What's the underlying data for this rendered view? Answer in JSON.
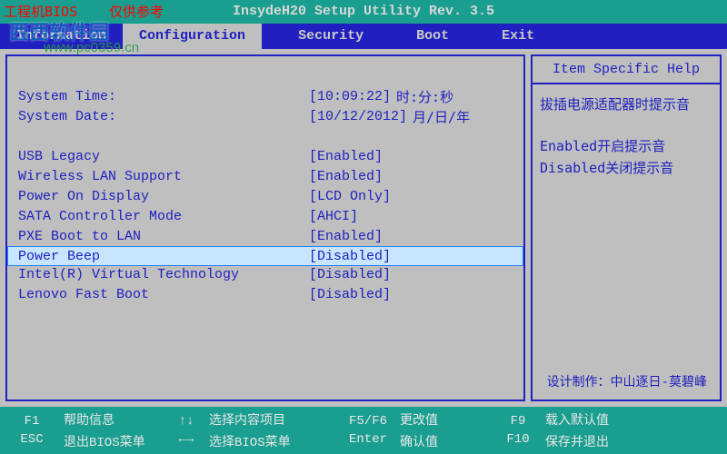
{
  "watermark": {
    "bios": "工程机BIOS",
    "ref": "仅供参考",
    "site": "西西软件园",
    "url": "www.pc0359.cn"
  },
  "header": {
    "title": "InsydeH20 Setup Utility Rev. 3.5"
  },
  "tabs": [
    "Information",
    "Configuration",
    "Security",
    "Boot",
    "Exit"
  ],
  "active_tab": "Configuration",
  "fields": {
    "time_label": "System Time:",
    "time_val": "[10:09:22]",
    "time_note": "时:分:秒",
    "date_label": "System Date:",
    "date_val": "[10/12/2012]",
    "date_note": "月/日/年",
    "usb_label": "USB Legacy",
    "usb_val": "[Enabled]",
    "wlan_label": "Wireless LAN Support",
    "wlan_val": "[Enabled]",
    "pod_label": "Power On Display",
    "pod_val": "[LCD Only]",
    "sata_label": "SATA Controller Mode",
    "sata_val": "[AHCI]",
    "pxe_label": "PXE Boot to LAN",
    "pxe_val": "[Enabled]",
    "beep_label": "Power Beep",
    "beep_val": "[Disabled]",
    "vt_label": "Intel(R) Virtual Technology",
    "vt_val": "[Disabled]",
    "lfb_label": "Lenovo Fast Boot",
    "lfb_val": "[Disabled]"
  },
  "help": {
    "title": "Item Specific Help",
    "line1": "拔插电源适配器时提示音",
    "line2": "Enabled开启提示音",
    "line3": "Disabled关闭提示音",
    "credit": "设计制作：中山逐日-莫碧峰"
  },
  "footer": {
    "f1k": "F1",
    "f1t": "帮助信息",
    "esck": "ESC",
    "esct": "退出BIOS菜单",
    "arr1": "↑↓",
    "arr1t": "选择内容项目",
    "arr2": "←→",
    "arr2t": "选择BIOS菜单",
    "f56": "F5/F6",
    "f56t": "更改值",
    "entk": "Enter",
    "entt": "确认值",
    "f9k": "F9",
    "f9t": "载入默认值",
    "f10k": "F10",
    "f10t": "保存并退出"
  }
}
